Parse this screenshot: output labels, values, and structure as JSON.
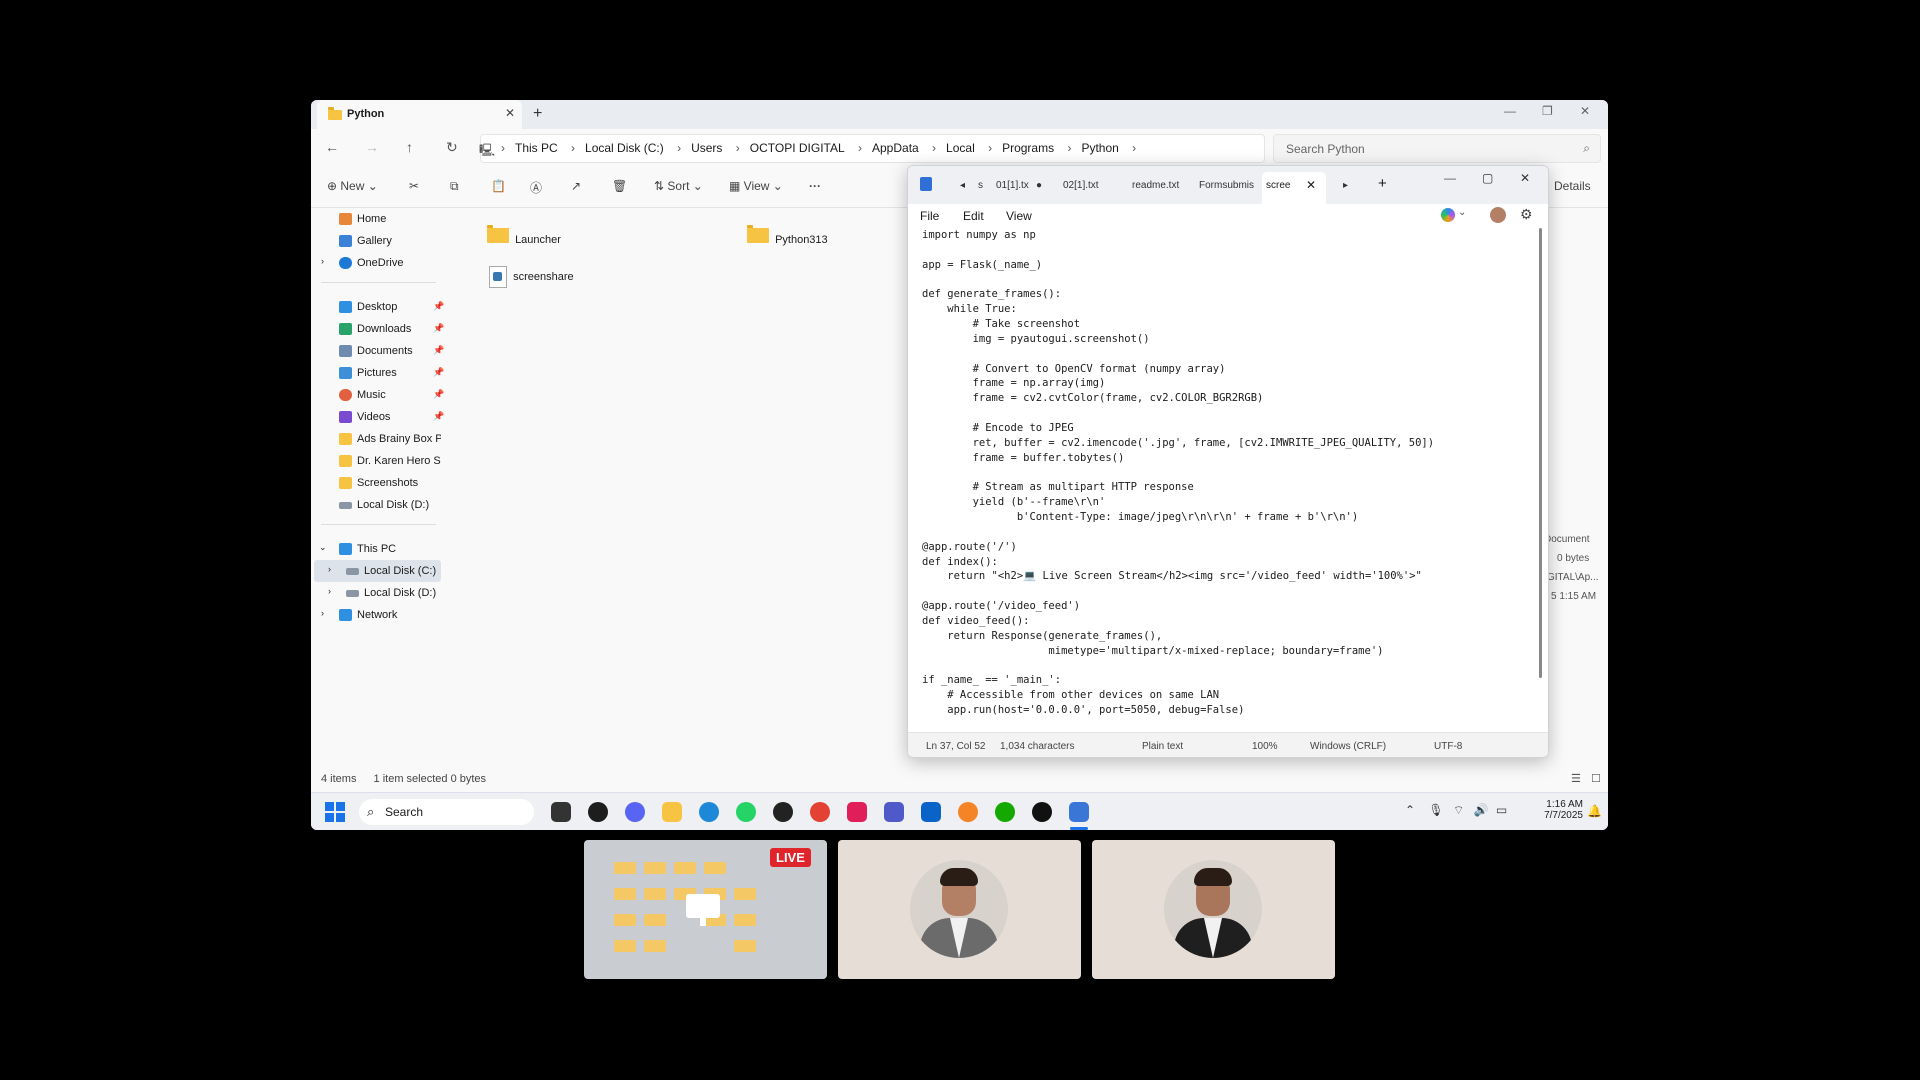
{
  "explorer": {
    "tab_title": "Python",
    "breadcrumbs": [
      "This PC",
      "Local Disk (C:)",
      "Users",
      "OCTOPI DIGITAL",
      "AppData",
      "Local",
      "Programs",
      "Python"
    ],
    "search_placeholder": "Search Python",
    "toolbar": {
      "new": "New",
      "sort": "Sort",
      "view": "View",
      "details": "Details"
    },
    "nav": {
      "home": "Home",
      "gallery": "Gallery",
      "onedrive": "OneDrive",
      "desktop": "Desktop",
      "downloads": "Downloads",
      "documents": "Documents",
      "pictures": "Pictures",
      "music": "Music",
      "videos": "Videos",
      "ads": "Ads Brainy Box Pack",
      "karen": "Dr. Karen Hero Sec",
      "screenshots": "Screenshots",
      "local_d": "Local Disk (D:)",
      "this_pc": "This PC",
      "local_c2": "Local Disk (C:)",
      "local_d2": "Local Disk (D:)",
      "network": "Network"
    },
    "files": {
      "launcher": "Launcher",
      "python313": "Python313",
      "screenshare": "screenshare"
    },
    "status": {
      "count": "4 items",
      "selected": "1 item selected  0 bytes"
    },
    "details_pane": {
      "type": "Document",
      "size": "0 bytes",
      "path": "GITAL\\Ap...",
      "time": "5 1:15 AM"
    }
  },
  "notepad": {
    "tabs": [
      "s",
      "01[1].tx",
      "02[1].txt",
      "readme.txt",
      "Formsubmis",
      "scree"
    ],
    "menu": {
      "file": "File",
      "edit": "Edit",
      "view": "View"
    },
    "code": "import numpy as np\n\napp = Flask(_name_)\n\ndef generate_frames():\n    while True:\n        # Take screenshot\n        img = pyautogui.screenshot()\n\n        # Convert to OpenCV format (numpy array)\n        frame = np.array(img)\n        frame = cv2.cvtColor(frame, cv2.COLOR_BGR2RGB)\n\n        # Encode to JPEG\n        ret, buffer = cv2.imencode('.jpg', frame, [cv2.IMWRITE_JPEG_QUALITY, 50])\n        frame = buffer.tobytes()\n\n        # Stream as multipart HTTP response\n        yield (b'--frame\\r\\n'\n               b'Content-Type: image/jpeg\\r\\n\\r\\n' + frame + b'\\r\\n')\n\n@app.route('/')\ndef index():\n    return \"<h2>💻 Live Screen Stream</h2><img src='/video_feed' width='100%'>\"\n\n@app.route('/video_feed')\ndef video_feed():\n    return Response(generate_frames(),\n                    mimetype='multipart/x-mixed-replace; boundary=frame')\n\nif _name_ == '_main_':\n    # Accessible from other devices on same LAN\n    app.run(host='0.0.0.0', port=5050, debug=False)",
    "status": {
      "position": "Ln 37, Col 52",
      "chars": "1,034 characters",
      "format": "Plain text",
      "zoom": "100%",
      "eol": "Windows (CRLF)",
      "encoding": "UTF-8"
    }
  },
  "taskbar": {
    "search": "Search",
    "time": "1:16 AM",
    "date": "7/7/2025"
  },
  "meeting": {
    "live": "LIVE"
  }
}
